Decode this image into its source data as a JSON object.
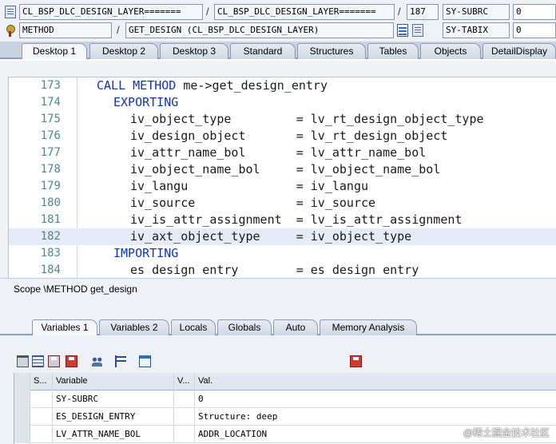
{
  "top": {
    "row1": {
      "class_left": "CL_BSP_DLC_DESIGN_LAYER=======",
      "class_right": "CL_BSP_DLC_DESIGN_LAYER=======",
      "line": "187",
      "sysvar_label": "SY-SUBRC",
      "sysvar_value": "0"
    },
    "row2": {
      "event_type": "METHOD",
      "event_name": "GET_DESIGN (CL_BSP_DLC_DESIGN_LAYER)",
      "sysvar_label": "SY-TABIX",
      "sysvar_value": "0"
    },
    "separator": "/"
  },
  "desktop_tabs": [
    "Desktop 1",
    "Desktop 2",
    "Desktop 3",
    "Standard",
    "Structures",
    "Tables",
    "Objects",
    "DetailDisplay"
  ],
  "editor": {
    "lines": [
      {
        "num": "173",
        "parts": [
          {
            "t": "CALL METHOD",
            "kw": true
          },
          {
            "t": " me->get_design_entry",
            "kw": false
          }
        ],
        "indent": 1
      },
      {
        "num": "174",
        "parts": [
          {
            "t": "EXPORTING",
            "kw": true
          }
        ],
        "indent": 3
      },
      {
        "num": "175",
        "parts": [
          {
            "t": "iv_object_type         = lv_rt_design_object_type",
            "kw": false
          }
        ],
        "indent": 5
      },
      {
        "num": "176",
        "parts": [
          {
            "t": "iv_design_object       = lv_rt_design_object",
            "kw": false
          }
        ],
        "indent": 5
      },
      {
        "num": "177",
        "parts": [
          {
            "t": "iv_attr_name_bol       = lv_attr_name_bol",
            "kw": false
          }
        ],
        "indent": 5
      },
      {
        "num": "178",
        "parts": [
          {
            "t": "iv_object_name_bol     = lv_object_name_bol",
            "kw": false
          }
        ],
        "indent": 5
      },
      {
        "num": "179",
        "parts": [
          {
            "t": "iv_langu               = iv_langu",
            "kw": false
          }
        ],
        "indent": 5
      },
      {
        "num": "180",
        "parts": [
          {
            "t": "iv_source              = iv_source",
            "kw": false
          }
        ],
        "indent": 5
      },
      {
        "num": "181",
        "parts": [
          {
            "t": "iv_is_attr_assignment  = lv_is_attr_assignment",
            "kw": false
          }
        ],
        "indent": 5
      },
      {
        "num": "182",
        "parts": [
          {
            "t": "iv_axt_object_type     = iv_object_type",
            "kw": false
          }
        ],
        "indent": 5,
        "highlight": true
      },
      {
        "num": "183",
        "parts": [
          {
            "t": "IMPORTING",
            "kw": true
          }
        ],
        "indent": 3
      },
      {
        "num": "184",
        "parts": [
          {
            "t": "es design entry        = es design entry",
            "kw": false
          }
        ],
        "indent": 5
      }
    ]
  },
  "scope_text": "Scope \\METHOD get_design",
  "variable_tabs": [
    "Variables 1",
    "Variables 2",
    "Locals",
    "Globals",
    "Auto",
    "Memory Analysis"
  ],
  "variables": {
    "columns": [
      "S...",
      "Variable",
      "V...",
      "Val."
    ],
    "rows": [
      {
        "variable": "SY-SUBRC",
        "value": "0"
      },
      {
        "variable": "ES_DESIGN_ENTRY",
        "value": "Structure: deep"
      },
      {
        "variable": "LV_ATTR_NAME_BOL",
        "value": "ADDR_LOCATION"
      }
    ]
  },
  "watermark": "@稀土掘金技术社区"
}
